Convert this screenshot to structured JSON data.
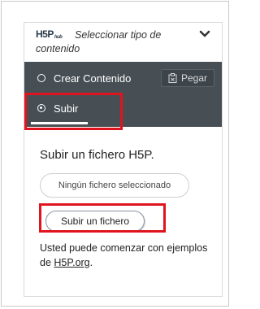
{
  "header": {
    "logo_text": "H5P",
    "logo_sub": "hub",
    "title": "Seleccionar tipo de contenido",
    "chevron_icon": "chevron-down-icon"
  },
  "tabs": [
    {
      "label": "Crear Contenido",
      "selected": false
    },
    {
      "label": "Subir",
      "selected": true
    }
  ],
  "paste_button": {
    "label": "Pegar",
    "icon": "clipboard-icon"
  },
  "upload": {
    "heading": "Subir un fichero H5P.",
    "file_placeholder": "Ningún fichero seleccionado",
    "button_label": "Subir un fichero",
    "note_prefix": "Usted puede comenzar con ejemplos de ",
    "note_link": "H5P.org",
    "note_suffix": "."
  },
  "colors": {
    "tab_bar": "#474f55",
    "highlight": "#e0141e"
  }
}
